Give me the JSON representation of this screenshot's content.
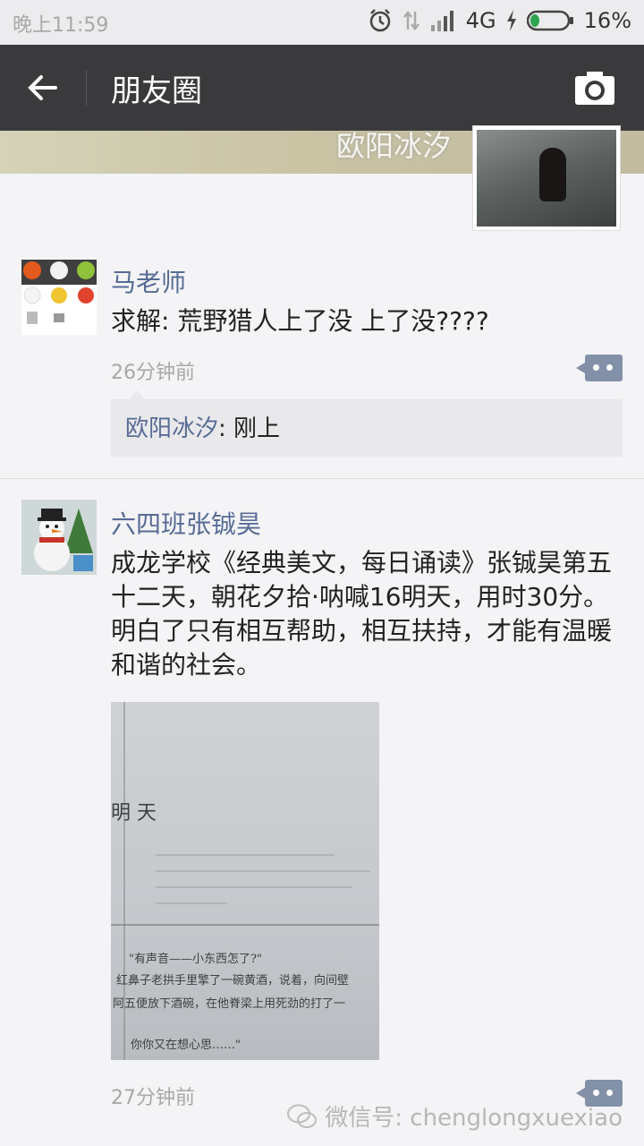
{
  "status_bar": {
    "time": "晚上11:59",
    "network": "4G",
    "battery": "16%"
  },
  "header": {
    "title": "朋友圈"
  },
  "cover": {
    "name": "欧阳冰汐"
  },
  "posts": [
    {
      "author": "马老师",
      "text": "求解: 荒野猎人上了没  上了没????",
      "time": "26分钟前",
      "comments": [
        {
          "who": "欧阳冰汐",
          "text": ": 刚上"
        }
      ]
    },
    {
      "author": "六四班张铖昊",
      "text": "成龙学校《经典美文，每日诵读》张铖昊第五十二天，朝花夕拾·呐喊16明天，用时30分。明白了只有相互帮助，相互扶持，才能有温暖和谐的社会。",
      "time": "27分钟前",
      "photo_text": {
        "heading": "明  天",
        "lines": [
          "\"有声音——小东西怎了?\"",
          "红鼻子老拱手里擎了一碗黄酒，说着，向间壁",
          "阿五便放下酒碗，在他脊梁上用死劲的打了一",
          "你你又在想心思……\""
        ]
      }
    }
  ],
  "watermark": {
    "text": "微信号: chenglongxuexiao"
  }
}
